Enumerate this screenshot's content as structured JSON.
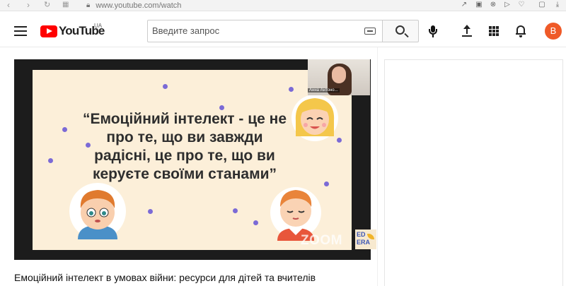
{
  "browser": {
    "url": "www.youtube.com/watch",
    "back_icon": "chevron-left-icon",
    "forward_icon": "chevron-right-icon",
    "reload_icon": "reload-icon",
    "lock_icon": "lock-icon"
  },
  "header": {
    "logo_text": "YouTube",
    "country_code": "UA",
    "search_placeholder": "Введите запрос",
    "avatar_letter": "B",
    "avatar_color": "#ef5a28",
    "brand_color": "#ff0000"
  },
  "video": {
    "slide_quote": "“Емоційний інтелект - це не про те, що ви завжди радісні, це про те, що ви керуєте своїми станами”",
    "participant_name": "Анна Антоно...",
    "watermark": "ZOOM",
    "brand_badge_top": "ED",
    "brand_badge_bottom": "ERA",
    "title": "Емоційний інтелект в умовах війни: ресурси для дітей та вчителів"
  }
}
